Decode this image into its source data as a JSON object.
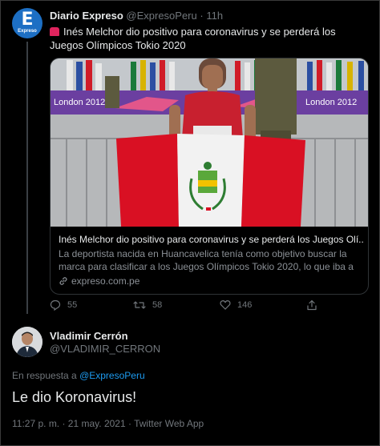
{
  "tweet1": {
    "avatar_letter": "E",
    "avatar_label": "Expreso",
    "name": "Diario Expreso",
    "handle": "@ExpresoPeru",
    "time": "11h",
    "text": "Inés Melchor dio positivo para coronavirus y se perderá los Juegos Olímpicos Tokio 2020",
    "card": {
      "banner_text": "London 2012",
      "title": "Inés Melchor dio positivo para coronavirus y se perderá los Juegos Olí...",
      "description": "La deportista nacida en Huancavelica tenía como objetivo buscar la marca para clasificar a los Juegos Olímpicos Tokio 2020, lo que iba a se...",
      "link": "expreso.com.pe"
    },
    "actions": {
      "replies": "55",
      "retweets": "58",
      "likes": "146"
    }
  },
  "tweet2": {
    "name": "Vladimir Cerrón",
    "handle": "@VLADIMIR_CERRON",
    "reply_prefix": "En respuesta a",
    "reply_to": "@ExpresoPeru",
    "text": "Le dio Koronavirus!",
    "meta": "11:27 p. m. · 21 may. 2021 · Twitter Web App"
  },
  "colors": {
    "background": "#000000",
    "link": "#1d9bf0",
    "muted": "#71767b",
    "flag_red": "#d91023",
    "expreso_blue": "#1d6fc4"
  }
}
